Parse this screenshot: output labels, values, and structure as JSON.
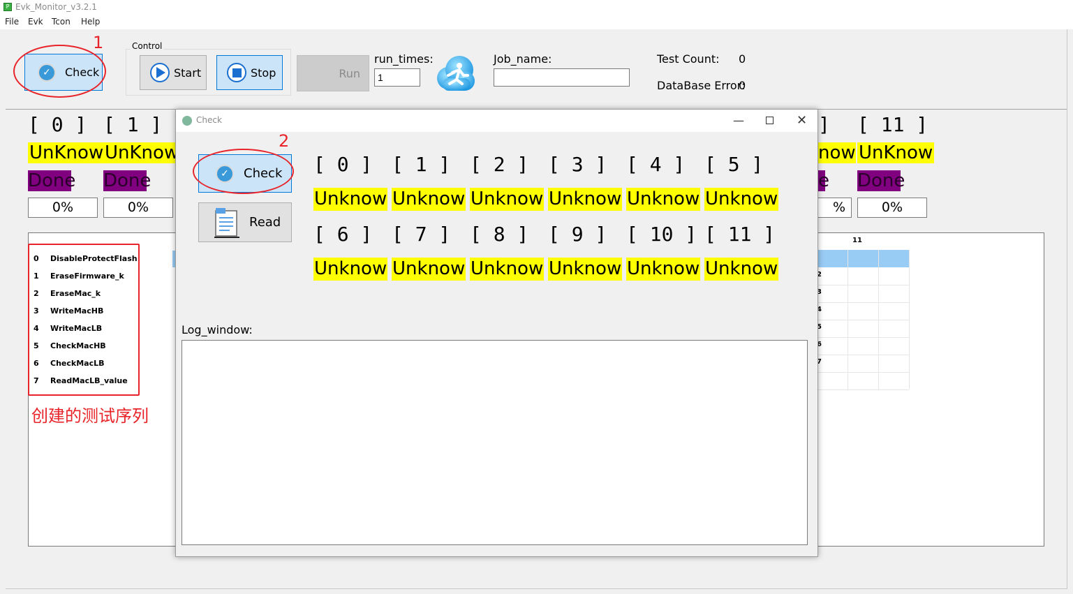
{
  "window": {
    "title": "Evk_Monitor_v3.2.1",
    "icon_glyph": "P"
  },
  "menu": [
    "File",
    "Evk",
    "Tcon",
    "Help"
  ],
  "toolbar": {
    "check_label": "Check",
    "control_group_label": "Control",
    "start_label": "Start",
    "stop_label": "Stop",
    "run_label": "Run",
    "run_times_label": "run_times:",
    "run_times_value": "1",
    "job_name_label": "Job_name:",
    "job_name_value": "",
    "test_count_label": "Test Count:",
    "test_count_value": "0",
    "db_error_label": "DataBase Error:",
    "db_error_value": "0"
  },
  "channels": [
    {
      "header": "[ 0 ]",
      "status": "UnKnow",
      "state": "Done",
      "progress": "0%"
    },
    {
      "header": "[ 1 ]",
      "status": "UnKnow",
      "state": "Done",
      "progress": "0%"
    },
    {
      "header": "]",
      "status": "now",
      "state": "e",
      "progress": "%"
    },
    {
      "header": "[ 11 ]",
      "status": "UnKnow",
      "state": "Done",
      "progress": "0%"
    }
  ],
  "sequence": [
    {
      "index": "0",
      "name": "DisableProtectFlash"
    },
    {
      "index": "1",
      "name": "EraseFirmware_k"
    },
    {
      "index": "2",
      "name": "EraseMac_k"
    },
    {
      "index": "3",
      "name": "WriteMacHB"
    },
    {
      "index": "4",
      "name": "WriteMacLB"
    },
    {
      "index": "5",
      "name": "CheckMacHB"
    },
    {
      "index": "6",
      "name": "CheckMacLB"
    },
    {
      "index": "7",
      "name": "ReadMacLB_value"
    }
  ],
  "sequence_note": "创建的测试序列",
  "grid_header_visible": "11",
  "grid_row_numbers": [
    "2",
    "3",
    "4",
    "5",
    "6",
    "7"
  ],
  "annotations": {
    "step1": "1",
    "step2": "2"
  },
  "dialog": {
    "title": "Check",
    "check_label": "Check",
    "read_label": "Read",
    "log_label": "Log_window:",
    "log_value": "",
    "slots": [
      {
        "header": "[ 0 ]",
        "status": "Unknow"
      },
      {
        "header": "[ 1 ]",
        "status": "Unknow"
      },
      {
        "header": "[ 2 ]",
        "status": "Unknow"
      },
      {
        "header": "[ 3 ]",
        "status": "Unknow"
      },
      {
        "header": "[ 4 ]",
        "status": "Unknow"
      },
      {
        "header": "[ 5 ]",
        "status": "Unknow"
      },
      {
        "header": "[ 6 ]",
        "status": "Unknow"
      },
      {
        "header": "[ 7 ]",
        "status": "Unknow"
      },
      {
        "header": "[ 8 ]",
        "status": "Unknow"
      },
      {
        "header": "[ 9 ]",
        "status": "Unknow"
      },
      {
        "header": "[ 10 ]",
        "status": "Unknow"
      },
      {
        "header": "[ 11 ]",
        "status": "Unknow"
      }
    ]
  },
  "colors": {
    "accent_blue": "#0078d7",
    "status_yellow": "#ffff00",
    "done_purple": "#800080",
    "annotation_red": "#e8242a"
  }
}
